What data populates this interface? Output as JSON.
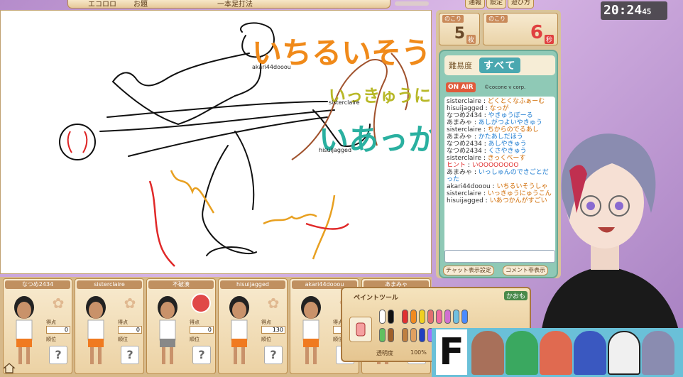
{
  "topbar": {
    "segments": [
      "エコロロ",
      "お題",
      "一本足打法"
    ],
    "buttons": [
      "通報",
      "設定",
      "遊び方"
    ]
  },
  "canvas": {
    "guesses": [
      {
        "text": "いちるいそう",
        "color": "#f08a1a"
      },
      {
        "text": "いっきゅうに",
        "color": "#b8b828"
      },
      {
        "text": "いあっか",
        "color": "#2ab0a0"
      }
    ],
    "name_tags": [
      "akari44dooou",
      "sisterclaire",
      "hisuijagged"
    ]
  },
  "counters": {
    "remaining_cards": {
      "label": "のこり",
      "value": "5",
      "unit": "枚"
    },
    "remaining_time": {
      "label": "のこり",
      "value": "6",
      "unit": "秒"
    }
  },
  "difficulty": {
    "label": "難易度",
    "value": "すべて"
  },
  "onair": "ON AIR",
  "copyright": "©cocone v corp.",
  "chat": [
    {
      "name": "sisterclaire",
      "text": "どくとくなふぁーむ",
      "color": "orange"
    },
    {
      "name": "hisuijagged",
      "text": "なっが",
      "color": "orange"
    },
    {
      "name": "なつめ2434",
      "text": "やきゅうぼーる",
      "color": "blue"
    },
    {
      "name": "あまみゃ",
      "text": "あしがつよいやきゅう",
      "color": "blue"
    },
    {
      "name": "sisterclaire",
      "text": "ちからのでるあし",
      "color": "orange"
    },
    {
      "name": "あまみゃ",
      "text": "かたあしだほう",
      "color": "blue"
    },
    {
      "name": "なつめ2434",
      "text": "あしやきゅう",
      "color": "blue"
    },
    {
      "name": "なつめ2434",
      "text": "くさやきゅう",
      "color": "blue"
    },
    {
      "name": "sisterclaire",
      "text": "きっくべーす",
      "color": "orange"
    },
    {
      "name": "ヒント",
      "text": "いOOOOOOOO",
      "color": "red",
      "hint": true
    },
    {
      "name": "あまみゃ",
      "text": "いっしゅんのできごとだった",
      "color": "blue"
    },
    {
      "name": "akari44dooou",
      "text": "いちるいそうしゃ",
      "color": "orange"
    },
    {
      "name": "sisterclaire",
      "text": "いっきゅうにゅうこん",
      "color": "orange"
    },
    {
      "name": "hisuijagged",
      "text": "いあつかんがすごい",
      "color": "orange"
    }
  ],
  "chat_buttons": {
    "settings": "チャット表示設定",
    "hide_comments": "コメント非表示"
  },
  "players": [
    {
      "name": "なつめ2434",
      "score_label": "得点",
      "score": "0",
      "rank_label": "順位",
      "rank": "?"
    },
    {
      "name": "sisterclaire",
      "score_label": "得点",
      "score": "0",
      "rank_label": "順位",
      "rank": "?"
    },
    {
      "name": "不破湊",
      "score_label": "得点",
      "score": "0",
      "rank_label": "順位",
      "rank": "?",
      "badge": "painter"
    },
    {
      "name": "hisuijagged",
      "score_label": "得点",
      "score": "130",
      "rank_label": "順位",
      "rank": "?"
    },
    {
      "name": "akari44dooou",
      "score_label": "得点",
      "score": "0",
      "rank_label": "順位",
      "rank": "?"
    },
    {
      "name": "あまみゃ",
      "score_label": "得点",
      "score": "",
      "rank_label": "順位",
      "rank": ""
    }
  ],
  "paint_tool": {
    "title": "ペイントツール",
    "extra": "かおも",
    "opacity_label": "透明度",
    "opacity_value": "100%"
  },
  "clock": {
    "time": "20:24",
    "seconds": "45"
  },
  "banner": {
    "team_letter": "F"
  },
  "colors": {
    "panel_teal": "#8fc9b6",
    "accent_orange": "#f08a1a"
  }
}
